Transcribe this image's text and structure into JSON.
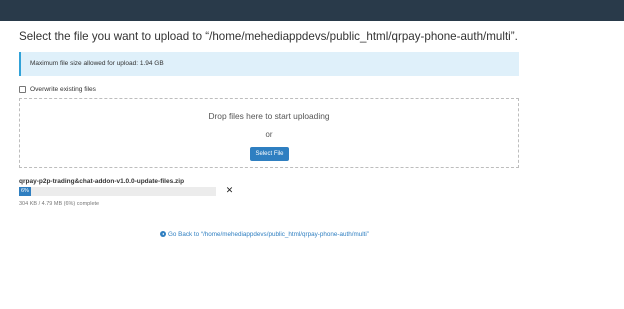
{
  "page": {
    "title": "Select the file you want to upload to “/home/mehediappdevs/public_html/qrpay-phone-auth/multi”."
  },
  "info": {
    "max_size_text": "Maximum file size allowed for upload: 1.94 GB"
  },
  "options": {
    "overwrite_label": "Overwrite existing files",
    "overwrite_checked": false
  },
  "dropzone": {
    "drop_text": "Drop files here to start uploading",
    "or_text": "or",
    "select_button_label": "Select File"
  },
  "upload": {
    "file_name": "qrpay-p2p-trading&chat-addon-v1.0.0-update-files.zip",
    "progress_percent": 6,
    "progress_label": "6%",
    "status_text": "304 KB / 4.79 MB (6%) complete",
    "cancel_icon": "close-icon"
  },
  "footer": {
    "back_link_text": "Go Back to “/home/mehediappdevs/public_html/qrpay-phone-auth/multi”",
    "back_icon": "arrow-left-circle-icon"
  },
  "colors": {
    "topbar": "#293a4a",
    "accent": "#2f7fc1",
    "info_bg": "#dff0fa",
    "info_border": "#31a2d8"
  }
}
